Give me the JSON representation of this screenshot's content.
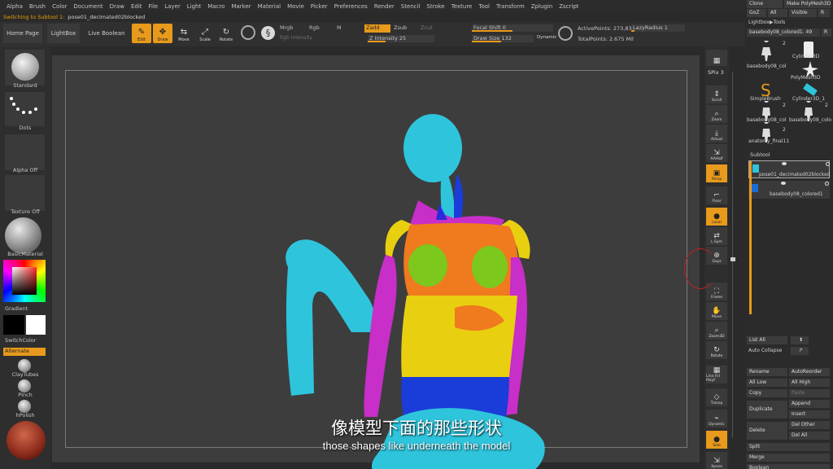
{
  "menu": [
    "Alpha",
    "Brush",
    "Color",
    "Document",
    "Draw",
    "Edit",
    "File",
    "Layer",
    "Light",
    "Macro",
    "Marker",
    "Material",
    "Movie",
    "Picker",
    "Preferences",
    "Render",
    "Stencil",
    "Stroke",
    "Texture",
    "Tool",
    "Transform",
    "Zplugin",
    "Zscript"
  ],
  "status": {
    "prefix": "Switching to Subtool 1:",
    "name": "pose01_decimated02blocked"
  },
  "toolbar": {
    "home": "Home Page",
    "lightbox": "LightBox",
    "live_boolean": "Live Boolean",
    "edit": "Edit",
    "draw": "Draw",
    "move": "Move",
    "scale": "Scale",
    "rotate": "Rotate",
    "mrgb": "Mrgb",
    "rgb": "Rgb",
    "m": "M",
    "rgb_intensity": "Rgb Intensity",
    "zadd": "Zadd",
    "zsub": "Zsub",
    "zcut": "Zcut",
    "z_intensity": "Z Intensity 25",
    "focal_shift": "Focal Shift 0",
    "draw_size": "Draw Size 132",
    "dynamic": "Dynamic",
    "active_points": "ActivePoints: 273,835",
    "total_points": "TotalPoints: 2.675 Mil",
    "lazy_radius": "LazyRadius 1"
  },
  "left": {
    "standard": "Standard",
    "dots": "Dots",
    "alpha_off": "Alpha Off",
    "texture_off": "Texture Off",
    "material": "BasicMaterial",
    "gradient": "Gradient",
    "switch_color": "SwitchColor",
    "alternate": "Alternate",
    "brushes": [
      "ClayTubes",
      "Pinch",
      "hPolish"
    ]
  },
  "right_shelf": {
    "spix": "SPix 3",
    "buttons": [
      "Scroll",
      "Zoom",
      "Actual",
      "AAHalf",
      "Persp",
      "Floor",
      "Local",
      "L.Sym",
      "Gxyz",
      "Frame",
      "Move",
      "Zoom3D",
      "Rotate",
      "Line Fill PolyF",
      "Transp",
      "Dynamic",
      "Solo",
      "Xpose"
    ]
  },
  "right_panel": {
    "top": [
      "Clone",
      "Make PolyMesh3D",
      "GoZ",
      "All",
      "Visible",
      "R"
    ],
    "lightbox_tools": "Lightbox▶Tools",
    "current_tool": "basebody08_colored1. 49",
    "r": "R",
    "tools": [
      "basebody08_colo",
      "Cylinder3D",
      "PolyMesh3D",
      "SimpleBrush",
      "Cylinder3D_1",
      "basebody08_colo",
      "basebody08_colo",
      "anatomy_final11"
    ],
    "tool_counts": [
      "2",
      "2",
      "2",
      "2"
    ],
    "subtool_title": "Subtool",
    "subtools": [
      "pose01_decimated02blocked",
      "basebody08_colored1"
    ],
    "buttons": {
      "list_all": "List All",
      "auto_collapse": "Auto Collapse",
      "rename": "Rename",
      "auto_reorder": "AutoReorder",
      "all_low": "All Low",
      "all_high": "All High",
      "copy": "Copy",
      "paste": "Paste",
      "duplicate": "Duplicate",
      "append": "Append",
      "insert": "Insert",
      "delete": "Delete",
      "del_other": "Del Other",
      "del_all": "Del All",
      "split": "Split",
      "merge": "Merge",
      "boolean": "Boolean"
    }
  },
  "subtitle": {
    "cn": "像模型下面的那些形状",
    "en": "those shapes like underneath the model"
  },
  "colors": {
    "accent": "#e89a1c",
    "cyan": "#2ec4dc",
    "magenta": "#c82ec8",
    "orange": "#f07a1e",
    "yellow": "#e8d010",
    "green": "#7cc81c",
    "blue": "#1a3cd8"
  }
}
